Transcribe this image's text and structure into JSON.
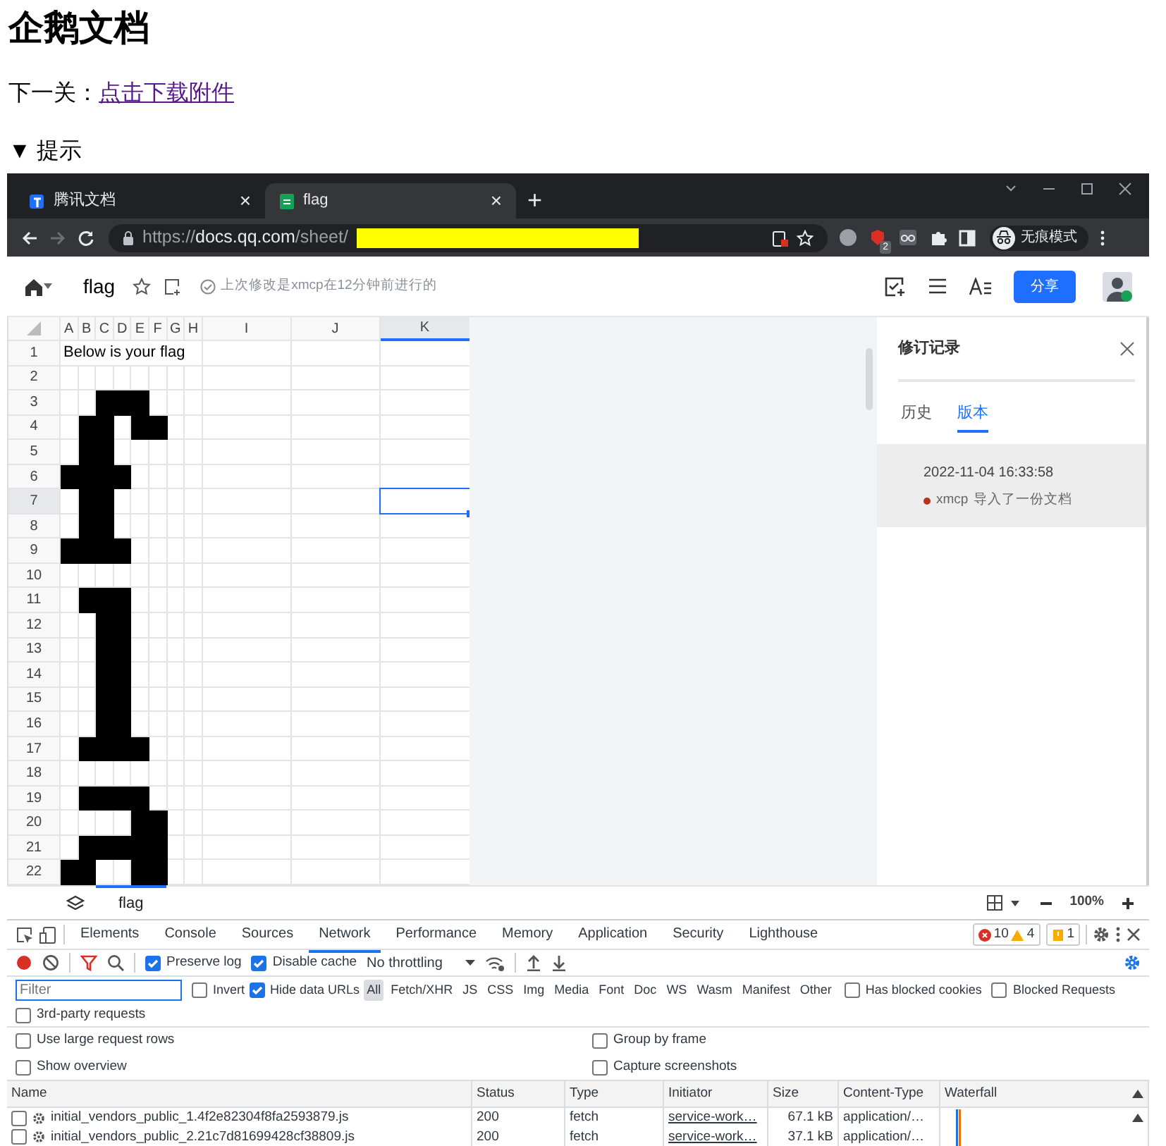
{
  "page": {
    "title": "企鹅文档",
    "next_label": "下一关：",
    "download_link": "点击下载附件",
    "hint": {
      "marker": "▼",
      "label": "提示",
      "expanded": true
    }
  },
  "browser": {
    "tabs": [
      {
        "title": "腾讯文档",
        "close": "×",
        "selected": false
      },
      {
        "title": "flag",
        "close": "×",
        "selected": true
      }
    ],
    "new_tab": "+",
    "forward_disabled": true,
    "address": {
      "scheme": "https://",
      "host": "docs.qq.com",
      "path": "/sheet/"
    },
    "extension_badge": "2",
    "profile": "无痕模式"
  },
  "doc": {
    "title": "flag",
    "save_status": "上次修改是xmcp在12分钟前进行的",
    "share": "分享"
  },
  "sheet": {
    "columns": [
      {
        "label": "A",
        "selected": false
      },
      {
        "label": "B",
        "selected": false
      },
      {
        "label": "C",
        "selected": false
      },
      {
        "label": "D",
        "selected": false
      },
      {
        "label": "E",
        "selected": false
      },
      {
        "label": "F",
        "selected": false
      },
      {
        "label": "G",
        "selected": false
      },
      {
        "label": "H",
        "selected": false
      },
      {
        "label": "I",
        "selected": false
      },
      {
        "label": "J",
        "selected": false
      },
      {
        "label": "K",
        "selected": true
      }
    ],
    "rows": [
      {
        "label": "1",
        "selected": false,
        "text": "Below is your flag"
      },
      {
        "label": "2",
        "selected": false,
        "fills": [
          false,
          false,
          false,
          false,
          false,
          false,
          false,
          false
        ]
      },
      {
        "label": "3",
        "selected": false,
        "fills": [
          false,
          false,
          true,
          true,
          true,
          false,
          false,
          false
        ]
      },
      {
        "label": "4",
        "selected": false,
        "fills": [
          false,
          true,
          true,
          false,
          true,
          true,
          false,
          false
        ]
      },
      {
        "label": "5",
        "selected": false,
        "fills": [
          false,
          true,
          true,
          false,
          false,
          false,
          false,
          false
        ]
      },
      {
        "label": "6",
        "selected": false,
        "fills": [
          true,
          true,
          true,
          true,
          false,
          false,
          false,
          false
        ]
      },
      {
        "label": "7",
        "selected": true,
        "fills": [
          false,
          true,
          true,
          false,
          false,
          false,
          false,
          false
        ]
      },
      {
        "label": "8",
        "selected": false,
        "fills": [
          false,
          true,
          true,
          false,
          false,
          false,
          false,
          false
        ]
      },
      {
        "label": "9",
        "selected": false,
        "fills": [
          true,
          true,
          true,
          true,
          false,
          false,
          false,
          false
        ]
      },
      {
        "label": "10",
        "selected": false,
        "fills": [
          false,
          false,
          false,
          false,
          false,
          false,
          false,
          false
        ]
      },
      {
        "label": "11",
        "selected": false,
        "fills": [
          false,
          true,
          true,
          true,
          false,
          false,
          false,
          false
        ]
      },
      {
        "label": "12",
        "selected": false,
        "fills": [
          false,
          false,
          true,
          true,
          false,
          false,
          false,
          false
        ]
      },
      {
        "label": "13",
        "selected": false,
        "fills": [
          false,
          false,
          true,
          true,
          false,
          false,
          false,
          false
        ]
      },
      {
        "label": "14",
        "selected": false,
        "fills": [
          false,
          false,
          true,
          true,
          false,
          false,
          false,
          false
        ]
      },
      {
        "label": "15",
        "selected": false,
        "fills": [
          false,
          false,
          true,
          true,
          false,
          false,
          false,
          false
        ]
      },
      {
        "label": "16",
        "selected": false,
        "fills": [
          false,
          false,
          true,
          true,
          false,
          false,
          false,
          false
        ]
      },
      {
        "label": "17",
        "selected": false,
        "fills": [
          false,
          true,
          true,
          true,
          true,
          false,
          false,
          false
        ]
      },
      {
        "label": "18",
        "selected": false,
        "fills": [
          false,
          false,
          false,
          false,
          false,
          false,
          false,
          false
        ]
      },
      {
        "label": "19",
        "selected": false,
        "fills": [
          false,
          true,
          true,
          true,
          true,
          false,
          false,
          false
        ]
      },
      {
        "label": "20",
        "selected": false,
        "fills": [
          false,
          false,
          false,
          false,
          true,
          true,
          false,
          false
        ]
      },
      {
        "label": "21",
        "selected": false,
        "fills": [
          false,
          true,
          true,
          true,
          true,
          true,
          false,
          false
        ]
      },
      {
        "label": "22",
        "selected": false,
        "fills": [
          true,
          true,
          false,
          false,
          true,
          true,
          false,
          false
        ]
      }
    ],
    "tab": "flag",
    "zoom": "100%"
  },
  "revisions": {
    "title": "修订记录",
    "tabs": [
      {
        "label": "历史",
        "selected": false
      },
      {
        "label": "版本",
        "selected": true
      }
    ],
    "entries": [
      {
        "time": "2022-11-04 16:33:58",
        "user": "xmcp",
        "action": "导入了一份文档",
        "color": "#b8321f"
      }
    ]
  },
  "devtools": {
    "tabs": [
      {
        "label": "Elements",
        "selected": false
      },
      {
        "label": "Console",
        "selected": false
      },
      {
        "label": "Sources",
        "selected": false
      },
      {
        "label": "Network",
        "selected": true
      },
      {
        "label": "Performance",
        "selected": false
      },
      {
        "label": "Memory",
        "selected": false
      },
      {
        "label": "Application",
        "selected": false
      },
      {
        "label": "Security",
        "selected": false
      },
      {
        "label": "Lighthouse",
        "selected": false
      }
    ],
    "errors": "10",
    "warnings": "4",
    "issues": "1",
    "recording": true,
    "filter_active": true,
    "options": [
      {
        "label": "Preserve log",
        "checked": true
      },
      {
        "label": "Disable cache",
        "checked": true
      }
    ],
    "throttling": "No throttling",
    "filter": {
      "placeholder": "Filter"
    },
    "flags": [
      {
        "label": "Invert",
        "checked": false
      },
      {
        "label": "Hide data URLs",
        "checked": true
      }
    ],
    "types": [
      {
        "label": "All",
        "selected": true
      },
      {
        "label": "Fetch/XHR",
        "selected": false
      },
      {
        "label": "JS",
        "selected": false
      },
      {
        "label": "CSS",
        "selected": false
      },
      {
        "label": "Img",
        "selected": false
      },
      {
        "label": "Media",
        "selected": false
      },
      {
        "label": "Font",
        "selected": false
      },
      {
        "label": "Doc",
        "selected": false
      },
      {
        "label": "WS",
        "selected": false
      },
      {
        "label": "Wasm",
        "selected": false
      },
      {
        "label": "Manifest",
        "selected": false
      },
      {
        "label": "Other",
        "selected": false
      }
    ],
    "blocked": [
      {
        "label": "Has blocked cookies",
        "checked": false
      },
      {
        "label": "Blocked Requests",
        "checked": false
      }
    ],
    "third_party": {
      "label": "3rd-party requests",
      "checked": false
    },
    "settings": [
      {
        "label": "Use large request rows",
        "checked": false
      },
      {
        "label": "Group by frame",
        "checked": false
      },
      {
        "label": "Show overview",
        "checked": false
      },
      {
        "label": "Capture screenshots",
        "checked": false
      }
    ],
    "columns": [
      "Name",
      "Status",
      "Type",
      "Initiator",
      "Size",
      "Content-Type",
      "Waterfall"
    ],
    "requests": [
      {
        "name": "initial_vendors_public_1.4f2e82304f8fa2593879.js",
        "status": "200",
        "type": "fetch",
        "initiator": "service-work…",
        "size": "67.1 kB",
        "content_type": "application/…",
        "checked": false
      },
      {
        "name": "initial_vendors_public_2.21c7d81699428cf38809.js",
        "status": "200",
        "type": "fetch",
        "initiator": "service-work…",
        "size": "37.1 kB",
        "content_type": "application/…",
        "checked": false
      }
    ]
  }
}
